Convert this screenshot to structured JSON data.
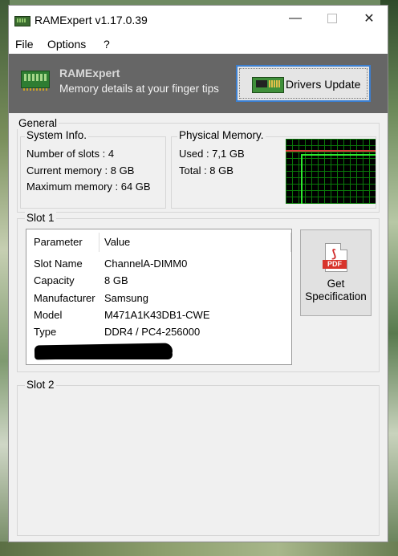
{
  "window": {
    "title": "RAMExpert v1.17.0.39",
    "minimize_glyph": "—",
    "close_glyph": "✕"
  },
  "menu": {
    "file": "File",
    "options": "Options",
    "help": "?"
  },
  "banner": {
    "app_name": "RAMExpert",
    "tagline": "Memory details at your finger tips",
    "drivers_update_label": "Drivers Update"
  },
  "general": {
    "label": "General",
    "system_info": {
      "label": "System Info.",
      "slots": "Number of slots : 4",
      "current_memory": "Current memory : 8 GB",
      "maximum_memory": "Maximum memory : 64 GB"
    },
    "physical_memory": {
      "label": "Physical Memory.",
      "used": "Used : 7,1 GB",
      "total": "Total : 8 GB"
    }
  },
  "slot1": {
    "label": "Slot 1",
    "columns": [
      "Parameter",
      "Value"
    ],
    "rows": [
      [
        "Slot Name",
        "ChannelA-DIMM0"
      ],
      [
        "Capacity",
        "8 GB"
      ],
      [
        "Manufacturer",
        "Samsung"
      ],
      [
        "Model",
        "M471A1K43DB1-CWE"
      ],
      [
        "Type",
        "DDR4 / PC4-256000"
      ]
    ],
    "spec_button": {
      "line1": "Get",
      "line2": "Specification",
      "pdf_tag": "PDF"
    }
  },
  "slot2": {
    "label": "Slot 2"
  },
  "colors": {
    "banner_bg": "#666666",
    "graph_bg": "#000000",
    "graph_grid": "#0a7a0a",
    "graph_used_line": "#2eea2e",
    "graph_total_line": "#d63a3a",
    "focus_border": "#3c7fd0"
  }
}
